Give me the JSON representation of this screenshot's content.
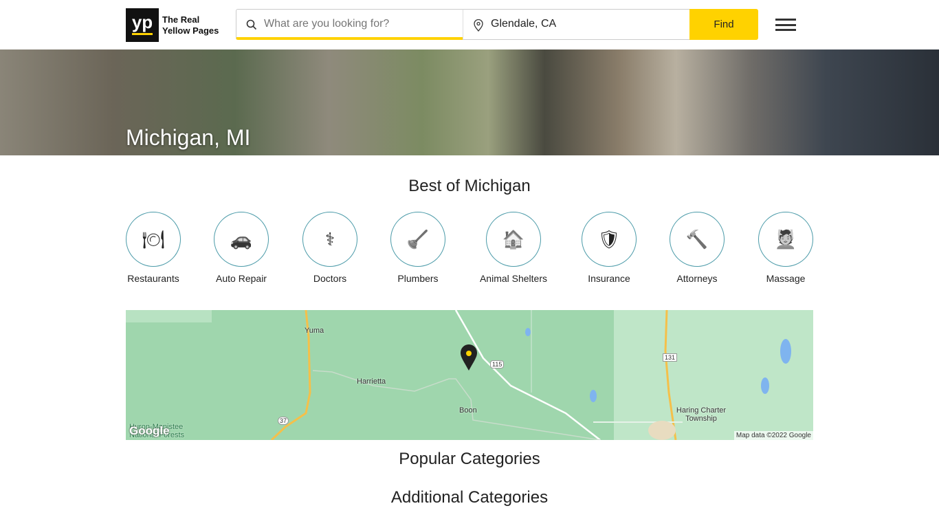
{
  "header": {
    "logo_mark": "yp",
    "logo_text_line1": "The Real",
    "logo_text_line2": "Yellow Pages",
    "search_placeholder": "What are you looking for?",
    "location_value": "Glendale, CA",
    "find_label": "Find"
  },
  "hero": {
    "title": "Michigan, MI"
  },
  "best": {
    "heading": "Best of Michigan",
    "categories": [
      {
        "label": "Restaurants",
        "icon": "plate-fork-knife-icon"
      },
      {
        "label": "Auto Repair",
        "icon": "car-wrench-icon"
      },
      {
        "label": "Doctors",
        "icon": "caduceus-icon"
      },
      {
        "label": "Plumbers",
        "icon": "plunger-icon"
      },
      {
        "label": "Animal Shelters",
        "icon": "house-paw-icon"
      },
      {
        "label": "Insurance",
        "icon": "shield-person-icon"
      },
      {
        "label": "Attorneys",
        "icon": "gavel-icon"
      },
      {
        "label": "Massage",
        "icon": "massage-icon"
      }
    ]
  },
  "map": {
    "labels": {
      "yuma": "Yuma",
      "harrietta": "Harrietta",
      "boon": "Boon",
      "haring": "Haring Charter Township",
      "huron": "Huron-Manistee National Forests",
      "r115": "115",
      "r131": "131",
      "r37": "37"
    },
    "google": "Google",
    "attribution": "Map data ©2022 Google",
    "colors": {
      "forest": "#9fd6ad",
      "road_major": "#f5c04a",
      "water": "#7fb4ef"
    }
  },
  "sections": {
    "popular": "Popular Categories",
    "additional": "Additional Categories"
  }
}
